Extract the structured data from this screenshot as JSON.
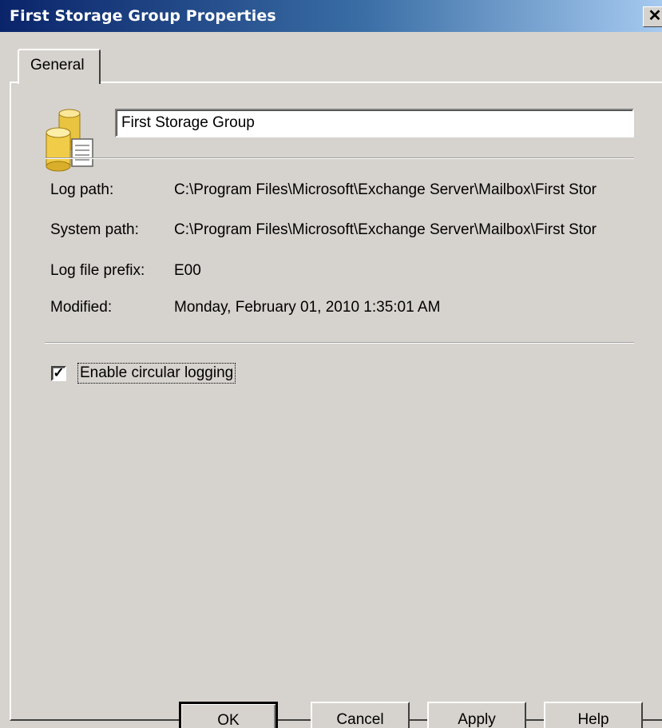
{
  "window": {
    "title": "First Storage Group Properties",
    "close_glyph": "✕"
  },
  "tabs": [
    {
      "label": "General",
      "selected": true
    }
  ],
  "general": {
    "icon": "storage-group-icon",
    "name_value": "First Storage Group",
    "properties": [
      {
        "label": "Log path:",
        "value": "C:\\Program Files\\Microsoft\\Exchange Server\\Mailbox\\First Stor"
      },
      {
        "label": "System path:",
        "value": "C:\\Program Files\\Microsoft\\Exchange Server\\Mailbox\\First Stor"
      },
      {
        "label": "Log file prefix:",
        "value": "E00"
      },
      {
        "label": "Modified:",
        "value": "Monday, February 01, 2010 1:35:01 AM"
      }
    ],
    "circular_logging": {
      "label": "Enable circular logging",
      "checked": true,
      "check_glyph": "✓"
    }
  },
  "buttons": {
    "ok": "OK",
    "cancel": "Cancel",
    "apply": "Apply",
    "help": "Help"
  },
  "colors": {
    "titlebar_start": "#0a246a",
    "titlebar_end": "#a6caf0",
    "dialog_bg": "#d6d3ce"
  }
}
